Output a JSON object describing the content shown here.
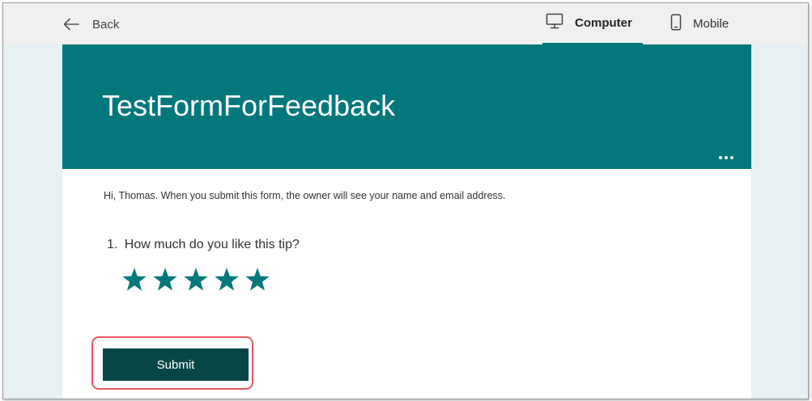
{
  "topbar": {
    "back_label": "Back",
    "tabs": [
      {
        "label": "Computer",
        "icon": "monitor-icon",
        "selected": true
      },
      {
        "label": "Mobile",
        "icon": "phone-icon",
        "selected": false
      }
    ]
  },
  "form": {
    "title": "TestFormForFeedback",
    "notice": "Hi, Thomas. When you submit this form, the owner will see your name and email address.",
    "questions": [
      {
        "number": "1.",
        "text": "How much do you like this tip?",
        "type": "rating",
        "scale": 5
      }
    ],
    "submit_label": "Submit"
  },
  "colors": {
    "accent": "#03787c",
    "submit": "#064646",
    "highlight": "#e5595d",
    "page_background": "#e7f0f2",
    "topbar_background": "#f0f0f0"
  }
}
